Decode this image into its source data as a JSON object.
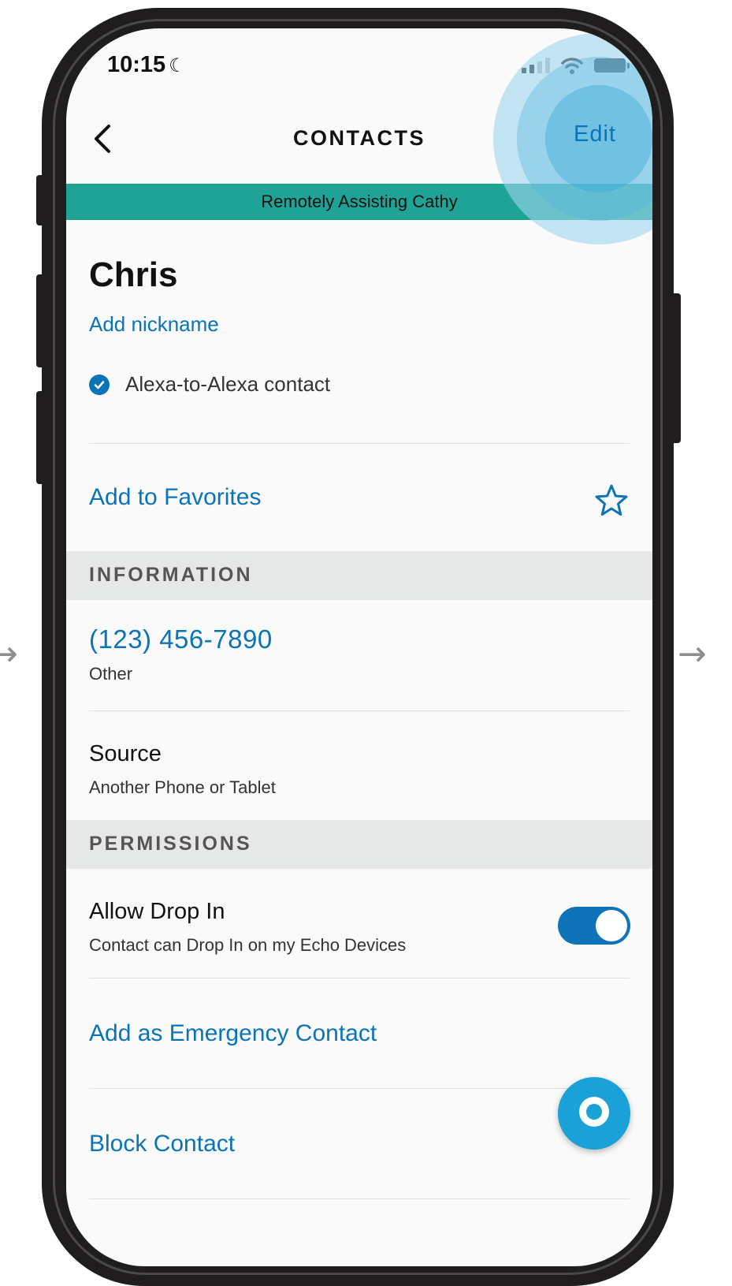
{
  "status_bar": {
    "time": "10:15",
    "moon": "☾"
  },
  "nav": {
    "title": "CONTACTS",
    "edit_label": "Edit"
  },
  "banner": {
    "text": "Remotely Assisting Cathy"
  },
  "contact": {
    "name": "Chris",
    "add_nickname": "Add nickname",
    "a2a_label": "Alexa-to-Alexa contact"
  },
  "favorites": {
    "label": "Add to Favorites"
  },
  "information": {
    "header": "INFORMATION",
    "phone_number": "(123) 456-7890",
    "phone_type": "Other",
    "source_title": "Source",
    "source_value": "Another Phone or Tablet"
  },
  "permissions": {
    "header": "PERMISSIONS",
    "drop_in_title": "Allow Drop In",
    "drop_in_sub": "Contact can Drop In on my Echo Devices",
    "drop_in_enabled": true
  },
  "actions": {
    "emergency_label": "Add as Emergency Contact",
    "block_label": "Block Contact"
  },
  "colors": {
    "accent": "#0b73b7",
    "banner": "#1fa396",
    "toggle_on": "#0e73b8",
    "fab": "#1aa1d8",
    "highlight": "#58b7de"
  },
  "icons": {
    "back": "chevron-left-icon",
    "check": "check-circle-icon",
    "star": "star-outline-icon",
    "alexa": "alexa-icon",
    "side_arrows": "arrow-right-icon"
  }
}
